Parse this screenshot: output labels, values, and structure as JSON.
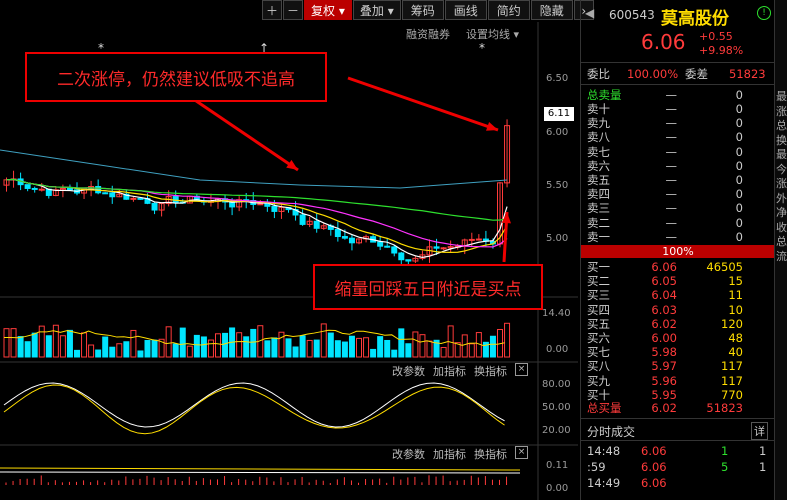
{
  "toolbar": {
    "buttons": [
      "复权",
      "叠加",
      "筹码",
      "画线",
      "简约",
      "隐藏"
    ],
    "sub_controls": {
      "margin": "融资融券",
      "ma_settings": "设置均线"
    }
  },
  "chart": {
    "price_axis": [
      "6.50",
      "6.00",
      "5.50",
      "5.00"
    ],
    "current_price_tag": "6.11",
    "volume_axis": [
      "14.40",
      "0.00"
    ],
    "kdj_axis": [
      "80.00",
      "50.00",
      "20.00"
    ],
    "macd_axis": [
      "0.11",
      "0.00"
    ],
    "pane_controls": {
      "params": "改参数",
      "add": "加指标",
      "swap": "换指标",
      "close": "×"
    }
  },
  "annotations": {
    "callout_top": "二次涨停，仍然建议低吸不追高",
    "callout_bottom": "缩量回踩五日附近是买点"
  },
  "stock": {
    "code": "600543",
    "name": "莫高股份",
    "price": "6.06",
    "change": "+0.55",
    "change_pct": "+9.98%"
  },
  "order_book": {
    "ratio_label": "委比",
    "ratio_value": "100.00%",
    "diff_label": "委差",
    "diff_value": "51823",
    "sell_total_label": "总卖量",
    "sell_total_price": "—",
    "sell_total_vol": "0",
    "sells": [
      {
        "label": "卖十",
        "price": "—",
        "vol": "0"
      },
      {
        "label": "卖九",
        "price": "—",
        "vol": "0"
      },
      {
        "label": "卖八",
        "price": "—",
        "vol": "0"
      },
      {
        "label": "卖七",
        "price": "—",
        "vol": "0"
      },
      {
        "label": "卖六",
        "price": "—",
        "vol": "0"
      },
      {
        "label": "卖五",
        "price": "—",
        "vol": "0"
      },
      {
        "label": "卖四",
        "price": "—",
        "vol": "0"
      },
      {
        "label": "卖三",
        "price": "—",
        "vol": "0"
      },
      {
        "label": "卖二",
        "price": "—",
        "vol": "0"
      },
      {
        "label": "卖一",
        "price": "—",
        "vol": "0"
      }
    ],
    "buy_ratio": "100%",
    "buys": [
      {
        "label": "买一",
        "price": "6.06",
        "vol": "46505"
      },
      {
        "label": "买二",
        "price": "6.05",
        "vol": "15"
      },
      {
        "label": "买三",
        "price": "6.04",
        "vol": "11"
      },
      {
        "label": "买四",
        "price": "6.03",
        "vol": "10"
      },
      {
        "label": "买五",
        "price": "6.02",
        "vol": "120"
      },
      {
        "label": "买六",
        "price": "6.00",
        "vol": "48"
      },
      {
        "label": "买七",
        "price": "5.98",
        "vol": "40"
      },
      {
        "label": "买八",
        "price": "5.97",
        "vol": "117"
      },
      {
        "label": "买九",
        "price": "5.96",
        "vol": "117"
      },
      {
        "label": "买十",
        "price": "5.95",
        "vol": "770"
      }
    ],
    "buy_total_label": "总买量",
    "buy_total_price": "6.02",
    "buy_total_vol": "51823"
  },
  "ticks": {
    "title": "分时成交",
    "detail": "详",
    "rows": [
      {
        "time": "14:48",
        "price": "6.06",
        "vol": "1",
        "n": "1"
      },
      {
        "time": ":59",
        "price": "6.06",
        "vol": "5",
        "n": "1"
      },
      {
        "time": "14:49",
        "price": "6.06",
        "vol": "",
        "n": ""
      }
    ]
  },
  "edge_labels": [
    "最",
    "涨",
    "总",
    "换",
    "最",
    "今",
    "涨",
    "外",
    "净",
    "收",
    "总",
    "流"
  ]
}
